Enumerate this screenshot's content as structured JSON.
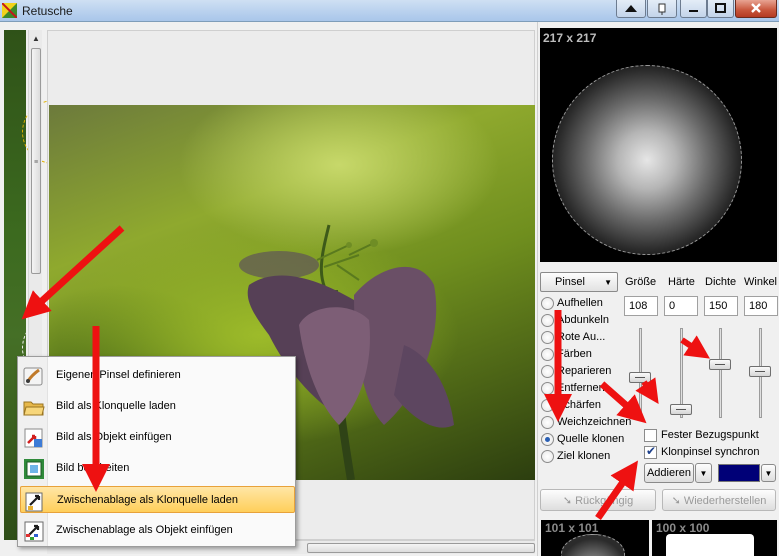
{
  "window": {
    "title": "Retusche"
  },
  "icons": {
    "app": "image-retouch-icon",
    "up": "scroll-up-arrow-icon",
    "down": "scroll-down-arrow-icon"
  },
  "preview": {
    "size_label": "217 x 217"
  },
  "brush": {
    "mode_selected": "Pinsel",
    "columns": [
      "Größe",
      "Härte",
      "Dichte",
      "Winkel"
    ],
    "values": [
      "108",
      "0",
      "150",
      "180"
    ]
  },
  "tools": [
    {
      "label": "Aufhellen",
      "selected": false
    },
    {
      "label": "Abdunkeln",
      "selected": false
    },
    {
      "label": "Rote Au...",
      "selected": false
    },
    {
      "label": "Färben",
      "selected": false
    },
    {
      "label": "Reparieren",
      "selected": false
    },
    {
      "label": "Entfernen",
      "selected": false
    },
    {
      "label": "Schärfen",
      "selected": false
    },
    {
      "label": "Weichzeichnen",
      "selected": false
    },
    {
      "label": "Quelle klonen",
      "selected": true
    },
    {
      "label": "Ziel klonen",
      "selected": false
    }
  ],
  "options": {
    "fixed_ref": {
      "label": "Fester Bezugspunkt",
      "checked": false
    },
    "clone_sync": {
      "label": "Klonpinsel synchron",
      "checked": true
    },
    "blend_mode": "Addieren",
    "color": "#000077"
  },
  "history": {
    "undo": "Rückgängig",
    "redo": "Wiederherstellen"
  },
  "thumbnails": [
    {
      "label": "101 x 101"
    },
    {
      "label": "100 x 100"
    }
  ],
  "context_menu": {
    "items": [
      {
        "label": "Eigenen Pinsel definieren",
        "icon": "brush-define-icon"
      },
      {
        "label": "Bild als Klonquelle laden",
        "icon": "folder-open-icon"
      },
      {
        "label": "Bild als Objekt einfügen",
        "icon": "insert-object-icon"
      },
      {
        "label": "Bild bearbeiten",
        "icon": "edit-image-icon"
      },
      {
        "label": "Zwischenablage als Klonquelle laden",
        "icon": "clipboard-clone-icon",
        "highlighted": true
      },
      {
        "label": "Zwischenablage als Objekt einfügen",
        "icon": "clipboard-object-icon"
      }
    ]
  },
  "colors": {
    "arrow": "#ee1111",
    "highlight": "#ffcf5a",
    "accent": "#2a5fb3"
  }
}
